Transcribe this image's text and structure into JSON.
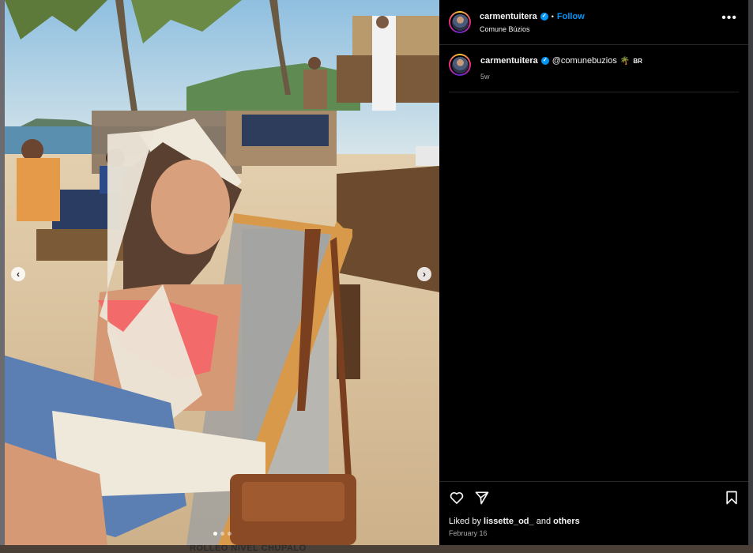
{
  "post": {
    "username": "carmentuitera",
    "follow_label": "Follow",
    "separator": "•",
    "location": "Comune Búzios",
    "more_glyph": "•••",
    "verified_glyph": "✓",
    "caption": {
      "username": "carmentuitera",
      "mention": "@comunebuzios",
      "emoji_glyph": "🌴",
      "flag_text": "BR",
      "time_ago": "5w"
    },
    "likes": {
      "prefix": "Liked by",
      "user": "lissette_od_",
      "middle": "and",
      "others": "others"
    },
    "date": "February 16"
  },
  "carousel": {
    "prev_glyph": "‹",
    "next_glyph": "›",
    "slide_count": 3,
    "active_slide": 1
  },
  "icons": {
    "like": "heart-icon",
    "share": "share-icon",
    "save": "bookmark-icon",
    "more": "more-options-icon"
  },
  "background": {
    "caption_text": "ROLLEO NIVEL CHUPALO"
  },
  "colors": {
    "panel_bg": "#000000",
    "link_blue": "#0095f6",
    "verified_blue": "#0095f6",
    "text_primary": "#f5f5f5",
    "text_secondary": "#a8a8a8"
  }
}
